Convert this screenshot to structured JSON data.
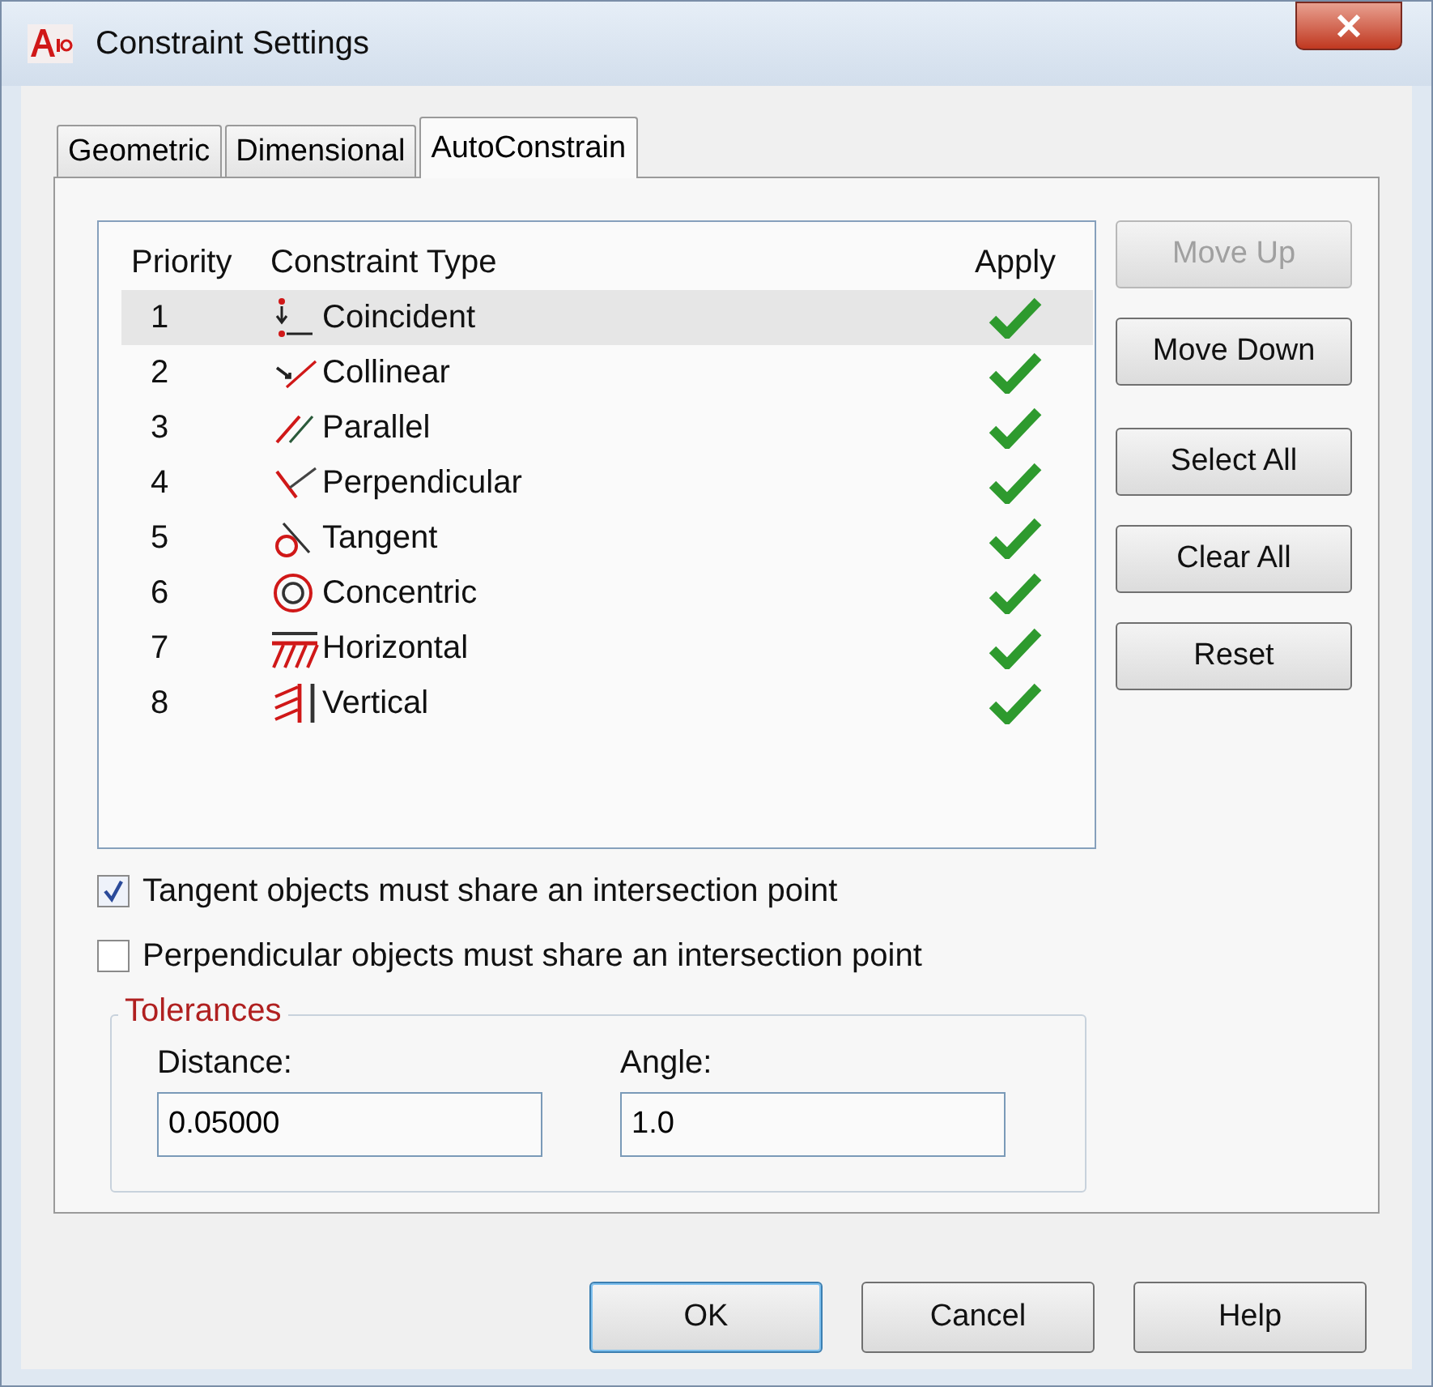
{
  "window": {
    "title": "Constraint Settings"
  },
  "tabs": [
    {
      "label": "Geometric",
      "selected": false
    },
    {
      "label": "Dimensional",
      "selected": false
    },
    {
      "label": "AutoConstrain",
      "selected": true
    }
  ],
  "list": {
    "columns": [
      "Priority",
      "Constraint Type",
      "Apply"
    ],
    "rows": [
      {
        "priority": "1",
        "type": "Coincident",
        "apply": true,
        "selected": true
      },
      {
        "priority": "2",
        "type": "Collinear",
        "apply": true,
        "selected": false
      },
      {
        "priority": "3",
        "type": "Parallel",
        "apply": true,
        "selected": false
      },
      {
        "priority": "4",
        "type": "Perpendicular",
        "apply": true,
        "selected": false
      },
      {
        "priority": "5",
        "type": "Tangent",
        "apply": true,
        "selected": false
      },
      {
        "priority": "6",
        "type": "Concentric",
        "apply": true,
        "selected": false
      },
      {
        "priority": "7",
        "type": "Horizontal",
        "apply": true,
        "selected": false
      },
      {
        "priority": "8",
        "type": "Vertical",
        "apply": true,
        "selected": false
      }
    ]
  },
  "side_buttons": [
    {
      "label": "Move Up",
      "disabled": true
    },
    {
      "label": "Move Down",
      "disabled": false
    },
    {
      "label": "Select All",
      "disabled": false
    },
    {
      "label": "Clear All",
      "disabled": false
    },
    {
      "label": "Reset",
      "disabled": false
    }
  ],
  "options": [
    {
      "label": "Tangent objects must share an intersection point",
      "checked": true
    },
    {
      "label": "Perpendicular objects must share an intersection point",
      "checked": false
    }
  ],
  "tolerances": {
    "title": "Tolerances",
    "fields": [
      {
        "label": "Distance:",
        "value": "0.05000"
      },
      {
        "label": "Angle:",
        "value": "1.0"
      }
    ]
  },
  "buttons": [
    "OK",
    "Cancel",
    "Help"
  ]
}
